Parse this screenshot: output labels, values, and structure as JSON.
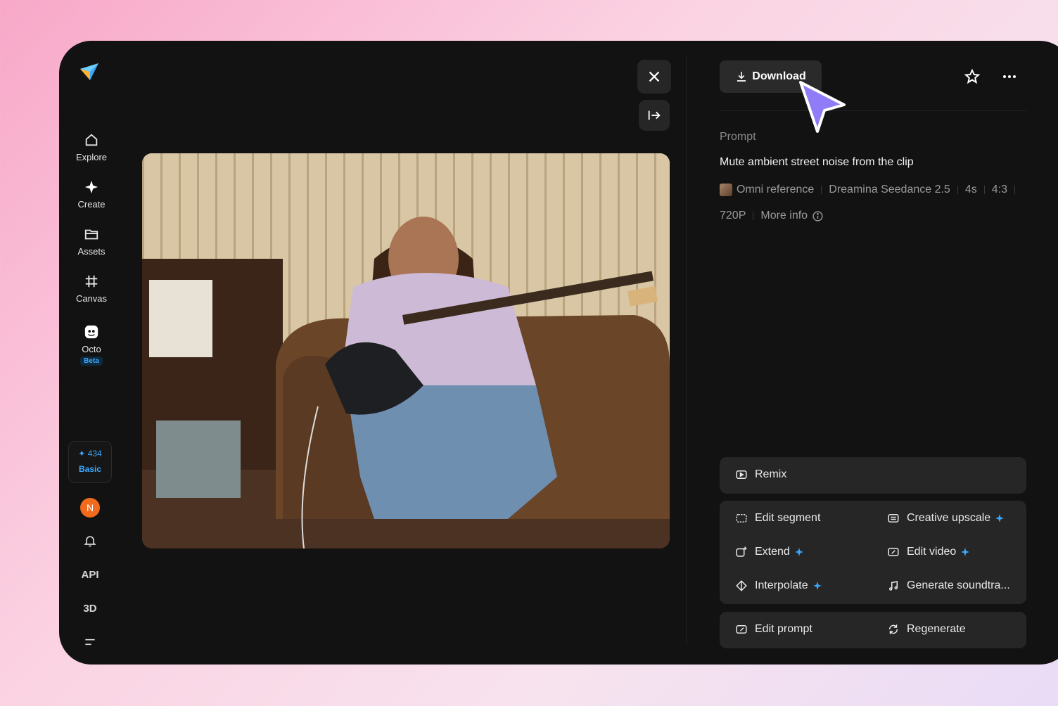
{
  "sidebar": {
    "items": [
      {
        "label": "Explore",
        "icon": "home-icon"
      },
      {
        "label": "Create",
        "icon": "sparkle-icon"
      },
      {
        "label": "Assets",
        "icon": "folder-icon"
      },
      {
        "label": "Canvas",
        "icon": "canvas-icon"
      },
      {
        "label": "Octo",
        "icon": "octo-icon",
        "badge": "Beta"
      }
    ],
    "credits": {
      "count": "434",
      "plan": "Basic"
    },
    "avatar_initial": "N",
    "api_label": "API",
    "three_d_label": "3D"
  },
  "toolbar": {
    "download_label": "Download"
  },
  "details": {
    "prompt_label": "Prompt",
    "prompt_text": "Mute ambient street noise from the clip",
    "reference": "Omni reference",
    "model": "Dreamina Seedance 2.5",
    "duration": "4s",
    "ratio": "4:3",
    "resolution": "720P",
    "more_info": "More info"
  },
  "actions": {
    "remix": "Remix",
    "edit_segment": "Edit segment",
    "creative_upscale": "Creative upscale",
    "extend": "Extend",
    "edit_video": "Edit video",
    "interpolate": "Interpolate",
    "generate_soundtrack": "Generate soundtra...",
    "edit_prompt": "Edit prompt",
    "regenerate": "Regenerate"
  },
  "colors": {
    "accent": "#3aa8ff",
    "window_bg": "#121212",
    "card_bg": "#262626",
    "cursor": "#8f7cf6"
  }
}
